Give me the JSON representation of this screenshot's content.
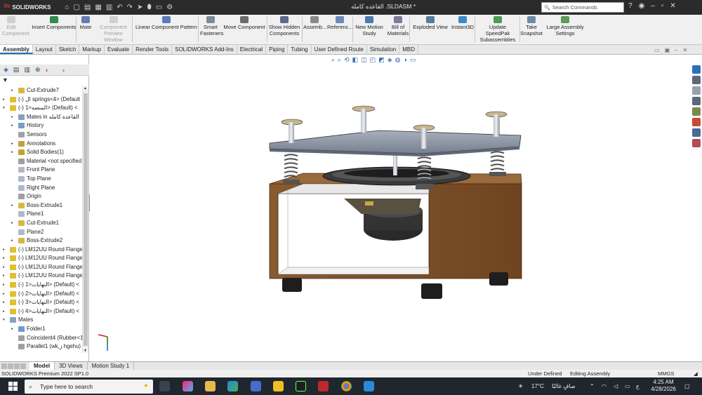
{
  "app": {
    "logo_text": "SOLIDWORKS",
    "doc_title": "القاعده كامله .SLDASM *",
    "search_placeholder": "Search Commands"
  },
  "command_manager": {
    "items": [
      {
        "label": "Edit\nComponent",
        "disabled": true
      },
      {
        "label": "Insert Components",
        "disabled": false
      },
      {
        "label": "Mate",
        "disabled": false
      },
      {
        "label": "Component\nPreview Window",
        "disabled": true
      },
      {
        "label": "Linear Component Pattern",
        "disabled": false
      },
      {
        "label": "Smart\nFasteners",
        "disabled": false
      },
      {
        "label": "Move Component",
        "disabled": false
      },
      {
        "label": "Show Hidden\nComponents",
        "disabled": false
      },
      {
        "label": "Assemb...",
        "disabled": false
      },
      {
        "label": "Referenc...",
        "disabled": false
      },
      {
        "label": "New Motion\nStudy",
        "disabled": false
      },
      {
        "label": "Bill of\nMaterials",
        "disabled": false
      },
      {
        "label": "Exploded View",
        "disabled": false
      },
      {
        "label": "Instant3D",
        "disabled": false
      },
      {
        "label": "Update SpeedPak\nSubassemblies",
        "disabled": false
      },
      {
        "label": "Take\nSnapshot",
        "disabled": false
      },
      {
        "label": "Large Assembly\nSettings",
        "disabled": false
      }
    ]
  },
  "tabs": [
    "Assembly",
    "Layout",
    "Sketch",
    "Markup",
    "Evaluate",
    "Render Tools",
    "SOLIDWORKS Add-Ins",
    "Electrical",
    "Piping",
    "Tubing",
    "User Defined Route",
    "Simulation",
    "MBD"
  ],
  "active_tab": "Assembly",
  "feature_tree": {
    "nodes": [
      {
        "label": "Cut-Extrude7",
        "indent": 1,
        "expander": "▸",
        "color": "#d8b840"
      },
      {
        "label": "(-) ال springs<4> (Default",
        "indent": 0,
        "expander": "▸",
        "color": "#e0c030"
      },
      {
        "label": "(-) المنصه<1> (Default) <",
        "indent": 0,
        "expander": "▾",
        "color": "#e0c030"
      },
      {
        "label": "Mates in القاعده كامله",
        "indent": 1,
        "expander": "▸",
        "color": "#8aa0c0"
      },
      {
        "label": "History",
        "indent": 1,
        "expander": "▸",
        "color": "#7a9cc8"
      },
      {
        "label": "Sensors",
        "indent": 1,
        "expander": "",
        "color": "#a0a0b0"
      },
      {
        "label": "Annotations",
        "indent": 1,
        "expander": "▸",
        "color": "#c0a040"
      },
      {
        "label": "Solid Bodies(1)",
        "indent": 1,
        "expander": "▸",
        "color": "#c8a030"
      },
      {
        "label": "Material <not specified",
        "indent": 1,
        "expander": "",
        "color": "#a0a0a0"
      },
      {
        "label": "Front Plane",
        "indent": 1,
        "expander": "",
        "color": "#b0b8c8"
      },
      {
        "label": "Top Plane",
        "indent": 1,
        "expander": "",
        "color": "#b0b8c8"
      },
      {
        "label": "Right Plane",
        "indent": 1,
        "expander": "",
        "color": "#b0b8c8"
      },
      {
        "label": "Origin",
        "indent": 1,
        "expander": "",
        "color": "#a0a0a0"
      },
      {
        "label": "Boss-Extrude1",
        "indent": 1,
        "expander": "▸",
        "color": "#d8b840"
      },
      {
        "label": "Plane1",
        "indent": 1,
        "expander": "",
        "color": "#b0b8c8"
      },
      {
        "label": "Cut-Extrude1",
        "indent": 1,
        "expander": "▸",
        "color": "#d8b840"
      },
      {
        "label": "Plane2",
        "indent": 1,
        "expander": "",
        "color": "#b0b8c8"
      },
      {
        "label": "Boss-Extrude2",
        "indent": 1,
        "expander": "▸",
        "color": "#d8b840"
      },
      {
        "label": "(-) LM12UU Round Flange",
        "indent": 0,
        "expander": "▸",
        "color": "#e0c030"
      },
      {
        "label": "(-) LM12UU Round Flange",
        "indent": 0,
        "expander": "▸",
        "color": "#e0c030"
      },
      {
        "label": "(-) LM12UU Round Flange",
        "indent": 0,
        "expander": "▸",
        "color": "#e0c030"
      },
      {
        "label": "(-) LM12UU Round Flange",
        "indent": 0,
        "expander": "▸",
        "color": "#e0c030"
      },
      {
        "label": "(-) النهايات<1> (Default) <",
        "indent": 0,
        "expander": "▸",
        "color": "#e0c030"
      },
      {
        "label": "(-) النهايات<2> (Default) <",
        "indent": 0,
        "expander": "▸",
        "color": "#e0c030"
      },
      {
        "label": "(-) النهايات<3> (Default) <",
        "indent": 0,
        "expander": "▸",
        "color": "#e0c030"
      },
      {
        "label": "(-) النهايات<4> (Default) <",
        "indent": 0,
        "expander": "▸",
        "color": "#e0c030"
      },
      {
        "label": "Mates",
        "indent": 0,
        "expander": "▾",
        "color": "#8aa0c0"
      },
      {
        "label": "Folder1",
        "indent": 1,
        "expander": "▸",
        "color": "#6a9ad0"
      },
      {
        "label": "Coincident4 (Rubber<1",
        "indent": 1,
        "expander": "",
        "color": "#a0a0a0"
      },
      {
        "label": "Parallel1 (wk,ز hgehu)",
        "indent": 1,
        "expander": "",
        "color": "#a0a0a0"
      }
    ]
  },
  "bottom_tabs": [
    "Model",
    "3D Views",
    "Motion Study 1"
  ],
  "active_bottom_tab": "Model",
  "status_bar": {
    "left": "SOLIDWORKS Premium 2022 SP1.0",
    "under_defined": "Under Defined",
    "editing": "Editing Assembly",
    "units": "MMGS"
  },
  "taskbar": {
    "search_placeholder": "Type here to search",
    "temperature": "17°C",
    "weather": "صافٍ غالبًا",
    "lang": "ع",
    "time": "4:25 AM",
    "date": "4/28/2026"
  },
  "colors": {
    "wood": "#7a4a22",
    "wood_dark": "#5a3416",
    "plate": "#8e98a8",
    "taskbar_bg": "#20262e",
    "accent": "#1f6fc1"
  }
}
